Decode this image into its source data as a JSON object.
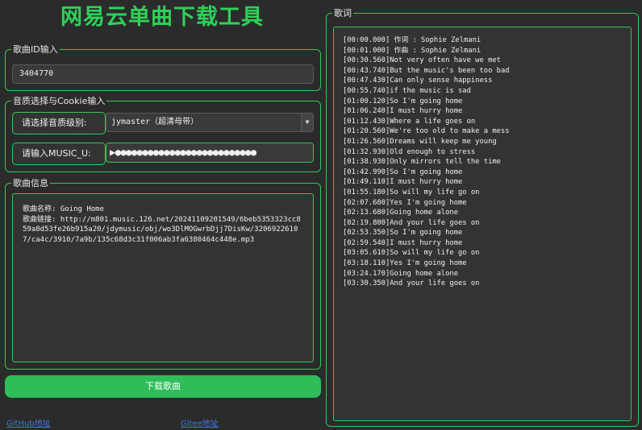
{
  "app": {
    "title": "网易云单曲下载工具"
  },
  "song_id_group": {
    "title": "歌曲ID输入",
    "value": "3404770"
  },
  "quality_group": {
    "title": "音质选择与Cookie输入",
    "quality_label": "请选择音质级别:",
    "quality_selected": "jymaster（超清母带）",
    "cookie_label": "请输入MUSIC_U:",
    "cookie_value": "▶●●●●●●●●●●●●●●●●●●●●●●●●●●"
  },
  "info_group": {
    "title": "歌曲信息",
    "text": "歌曲名称: Going Home\n歌曲链接: http://m801.music.126.net/20241109201549/6beb5353323cc859a8d53fe26b915a20/jdymusic/obj/wo3DlMOGwrbDjj7DisKw/32069226107/ca4c/3910/7a9b/135c68d3c31f006ab3fa6380464c448e.mp3"
  },
  "download_button": {
    "label": "下载歌曲"
  },
  "links": {
    "github": "GitHub地址",
    "gitee": "Gitee地址"
  },
  "lyrics_group": {
    "title": "歌词",
    "lines": [
      "[00:00.000] 作词 : Sophie Zelmani",
      "[00:01.000] 作曲 : Sophie Zelmani",
      "[00:30.560]Not very often have we met",
      "[00:43.740]But the music's been too bad",
      "[00:47.430]Can only sense happiness",
      "[00:55.740]if the music is sad",
      "[01:00.120]So I'm going home",
      "[01:06.240]I must hurry home",
      "[01:12.430]Where a life goes on",
      "[01:20.560]We're too old to make a mess",
      "[01:26.560]Dreams will keep me young",
      "[01:32.930]Old enough to stress",
      "[01:38.930]Only mirrors tell the time",
      "[01:42.990]So I'm going home",
      "[01:49.110]I must hurry home",
      "[01:55.180]So will my life go on",
      "[02:07.680]Yes I'm going home",
      "[02:13.680]Going home alone",
      "[02:19.800]And your life goes on",
      "[02:53.350]So I'm going home",
      "[02:59.540]I must hurry home",
      "[03:05.610]So will my life go on",
      "[03:18.110]Yes I'm going home",
      "[03:24.170]Going home alone",
      "[03:30.350]And your life goes on"
    ]
  },
  "colors": {
    "accent": "#34c759",
    "button": "#2ebd59",
    "title": "#2fd15a",
    "link": "#3c7be6",
    "background": "#2b2b2b"
  }
}
